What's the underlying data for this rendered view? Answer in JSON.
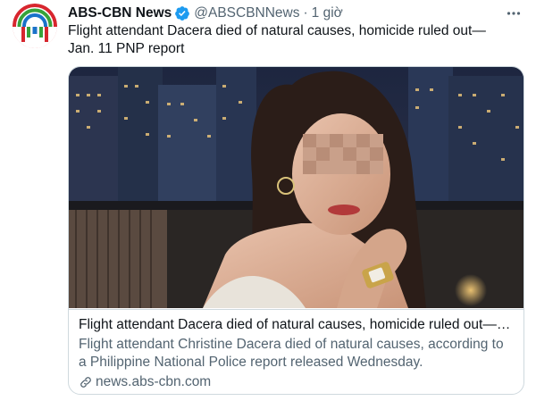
{
  "account": {
    "name": "ABS-CBN News",
    "handle": "@ABSCBNNews",
    "separator": "·",
    "time": "1 giờ"
  },
  "tweet": {
    "text": "Flight attendant Dacera died of natural causes, homicide ruled out— Jan. 11 PNP report"
  },
  "card": {
    "title": "Flight attendant Dacera died of natural causes, homicide ruled out— Ja...",
    "description": "Flight attendant Christine Dacera died of natural causes, according to a Philippine National Police report released Wednesday.",
    "domain": "news.abs-cbn.com"
  },
  "icons": {
    "avatar": "abs-cbn-logo",
    "verified": "verified-badge-icon",
    "more": "more-options-icon",
    "link": "link-icon"
  },
  "colors": {
    "brand_red": "#d7262e",
    "brand_green": "#37a33a",
    "brand_blue": "#1a73c9",
    "verified_blue": "#1d9bf0",
    "secondary_text": "#536471",
    "border": "#cfd9de"
  }
}
